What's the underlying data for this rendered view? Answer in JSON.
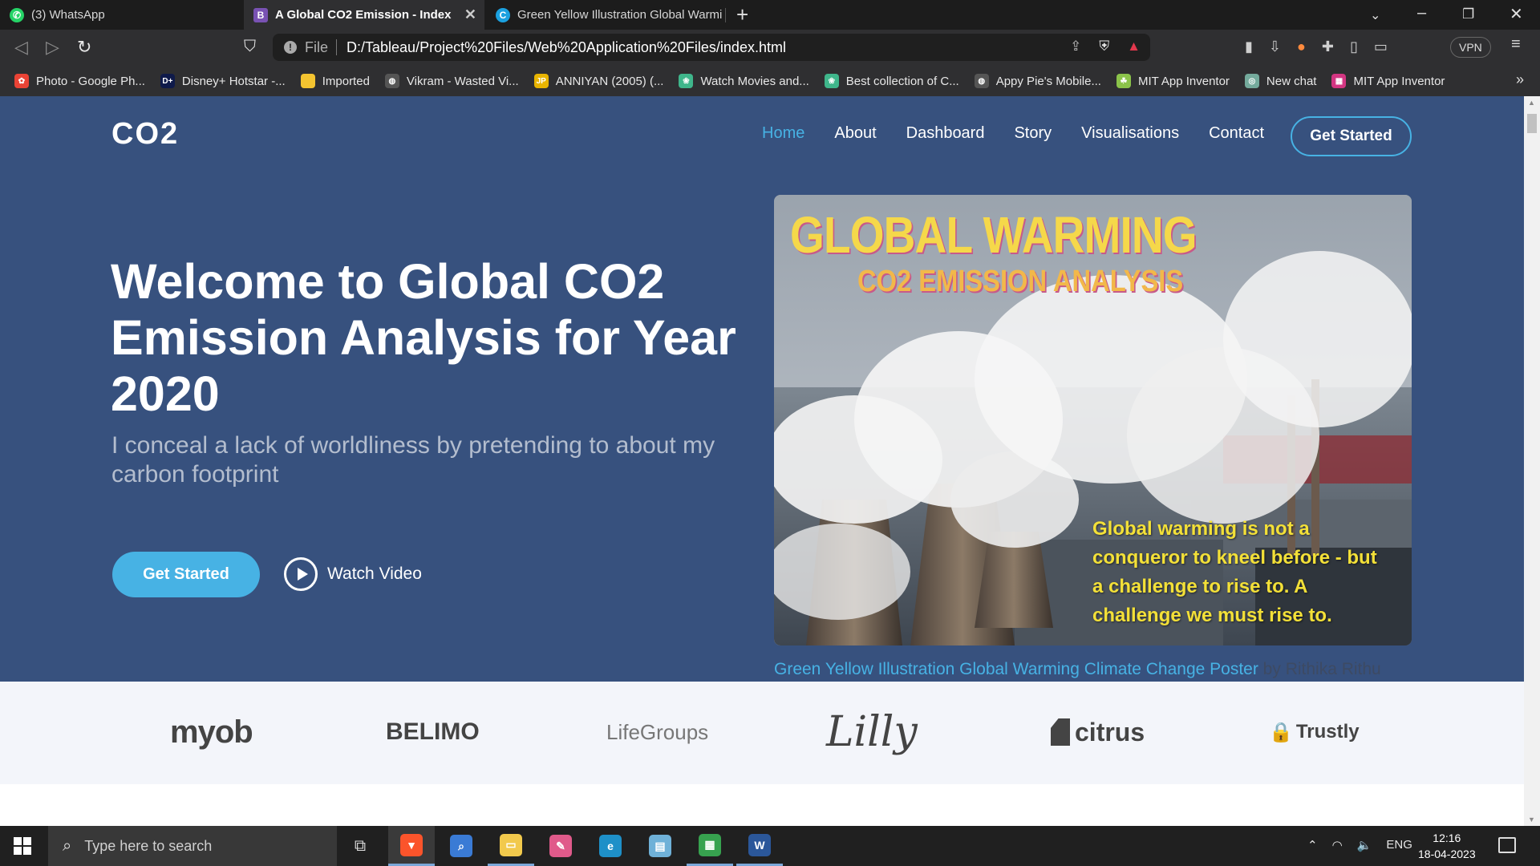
{
  "browser": {
    "tabs": [
      {
        "title": "(3) WhatsApp",
        "icon": "whatsapp-icon",
        "color": "#25d366",
        "glyph": "✆",
        "active": false
      },
      {
        "title": "A Global CO2 Emission - Index",
        "icon": "bootstrap-icon",
        "color": "#7952b3",
        "glyph": "B",
        "active": true
      },
      {
        "title": "Green Yellow Illustration Global Warmi",
        "icon": "canva-icon",
        "color": "#1ba1e0",
        "glyph": "C",
        "active": false
      }
    ],
    "address": {
      "scheme_label": "File",
      "url": "D:/Tableau/Project%20Files/Web%20Application%20Files/index.html"
    },
    "vpn_label": "VPN",
    "bookmarks": [
      {
        "label": "Photo - Google Ph...",
        "color": "#ea4335",
        "glyph": "✿"
      },
      {
        "label": "Disney+ Hotstar -...",
        "color": "#0f1a4a",
        "glyph": "D+"
      },
      {
        "label": "Imported",
        "color": "#f4c430",
        "glyph": ""
      },
      {
        "label": "Vikram - Wasted Vi...",
        "color": "#555555",
        "glyph": "◍"
      },
      {
        "label": "ANNIYAN (2005) (...",
        "color": "#e8b400",
        "glyph": "JP"
      },
      {
        "label": "Watch Movies and...",
        "color": "#3fb68b",
        "glyph": "❀"
      },
      {
        "label": "Best collection of C...",
        "color": "#3fb68b",
        "glyph": "❀"
      },
      {
        "label": "Appy Pie's Mobile...",
        "color": "#555555",
        "glyph": "◍"
      },
      {
        "label": "MIT App Inventor",
        "color": "#8bc34a",
        "glyph": "☘"
      },
      {
        "label": "New chat",
        "color": "#74aa9c",
        "glyph": "◎"
      },
      {
        "label": "MIT App Inventor",
        "color": "#d33682",
        "glyph": "▦"
      }
    ]
  },
  "page": {
    "logo": "CO2",
    "nav": [
      "Home",
      "About",
      "Dashboard",
      "Story",
      "Visualisations",
      "Contact"
    ],
    "nav_cta": "Get Started",
    "hero": {
      "title": "Welcome to Global CO2 Emission Analysis for Year 2020",
      "subtitle": "I conceal a lack of worldliness by pretending to about my carbon footprint",
      "cta": "Get Started",
      "watch": "Watch Video"
    },
    "poster": {
      "title": "GLOBAL WARMING",
      "subtitle": "CO2 EMISSION ANALYSIS",
      "quote": "Global warming is not a conqueror to kneel before - but a challenge to rise to. A challenge we must rise to."
    },
    "credit": {
      "link": "Green Yellow Illustration Global Warming Climate Change Poster",
      "by": " by Rithika Rithu"
    },
    "clients": [
      "myob",
      "BELIMO",
      "LifeGroups",
      "Lilly",
      "citrus",
      "Trustly"
    ]
  },
  "taskbar": {
    "search_placeholder": "Type here to search",
    "apps": [
      {
        "name": "brave",
        "color": "#fb542b",
        "glyph": "▼"
      },
      {
        "name": "search-app",
        "color": "#3a7bd5",
        "glyph": "⌕"
      },
      {
        "name": "file-explorer",
        "color": "#f2c94c",
        "glyph": "▭"
      },
      {
        "name": "paint",
        "color": "#e05a8a",
        "glyph": "✎"
      },
      {
        "name": "edge",
        "color": "#1e90c8",
        "glyph": "e"
      },
      {
        "name": "notepad",
        "color": "#6fb1d8",
        "glyph": "▤"
      },
      {
        "name": "sheets",
        "color": "#37a24f",
        "glyph": "▦"
      },
      {
        "name": "word",
        "color": "#2b579a",
        "glyph": "W"
      }
    ],
    "language": "ENG",
    "time": "12:16",
    "date": "18-04-2023"
  },
  "colors": {
    "hero_bg": "#37517e",
    "accent": "#47b2e4",
    "poster_title": "#f5d84a",
    "poster_quote": "#f3e038"
  }
}
